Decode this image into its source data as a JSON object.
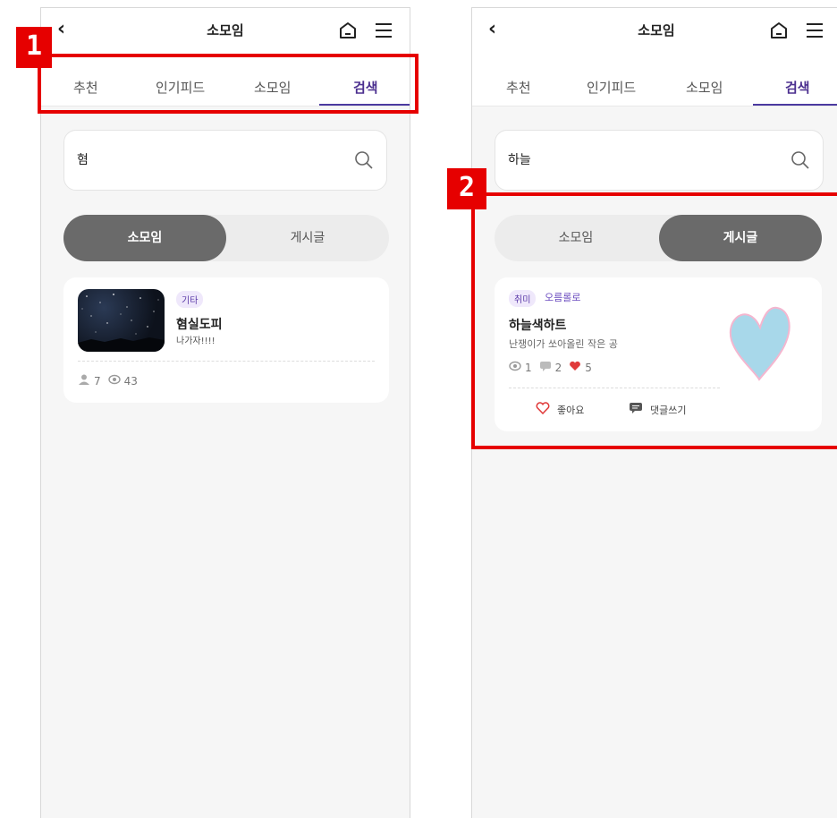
{
  "header": {
    "title": "소모임"
  },
  "tabs": [
    "추천",
    "인기피드",
    "소모임",
    "검색"
  ],
  "panel1": {
    "label": "1",
    "search_value": "혐",
    "toggle": [
      "소모임",
      "게시글"
    ],
    "card": {
      "tag": "기타",
      "name": "혐실도피",
      "desc": "나가자!!!!",
      "members": "7",
      "views": "43"
    }
  },
  "panel2": {
    "label": "2",
    "search_value": "하늘",
    "toggle": [
      "소모임",
      "게시글"
    ],
    "post": {
      "tag": "취미",
      "group": "오름롤로",
      "title": "하늘색하트",
      "desc": "난쟁이가 쏘아올린 작은 공",
      "views": "1",
      "comments": "2",
      "likes": "5",
      "like_label": "좋아요",
      "comment_label": "댓글쓰기"
    }
  },
  "colors": {
    "accent": "#4b3aa0",
    "highlight": "#e60000",
    "heart": "#a8d8ea"
  }
}
